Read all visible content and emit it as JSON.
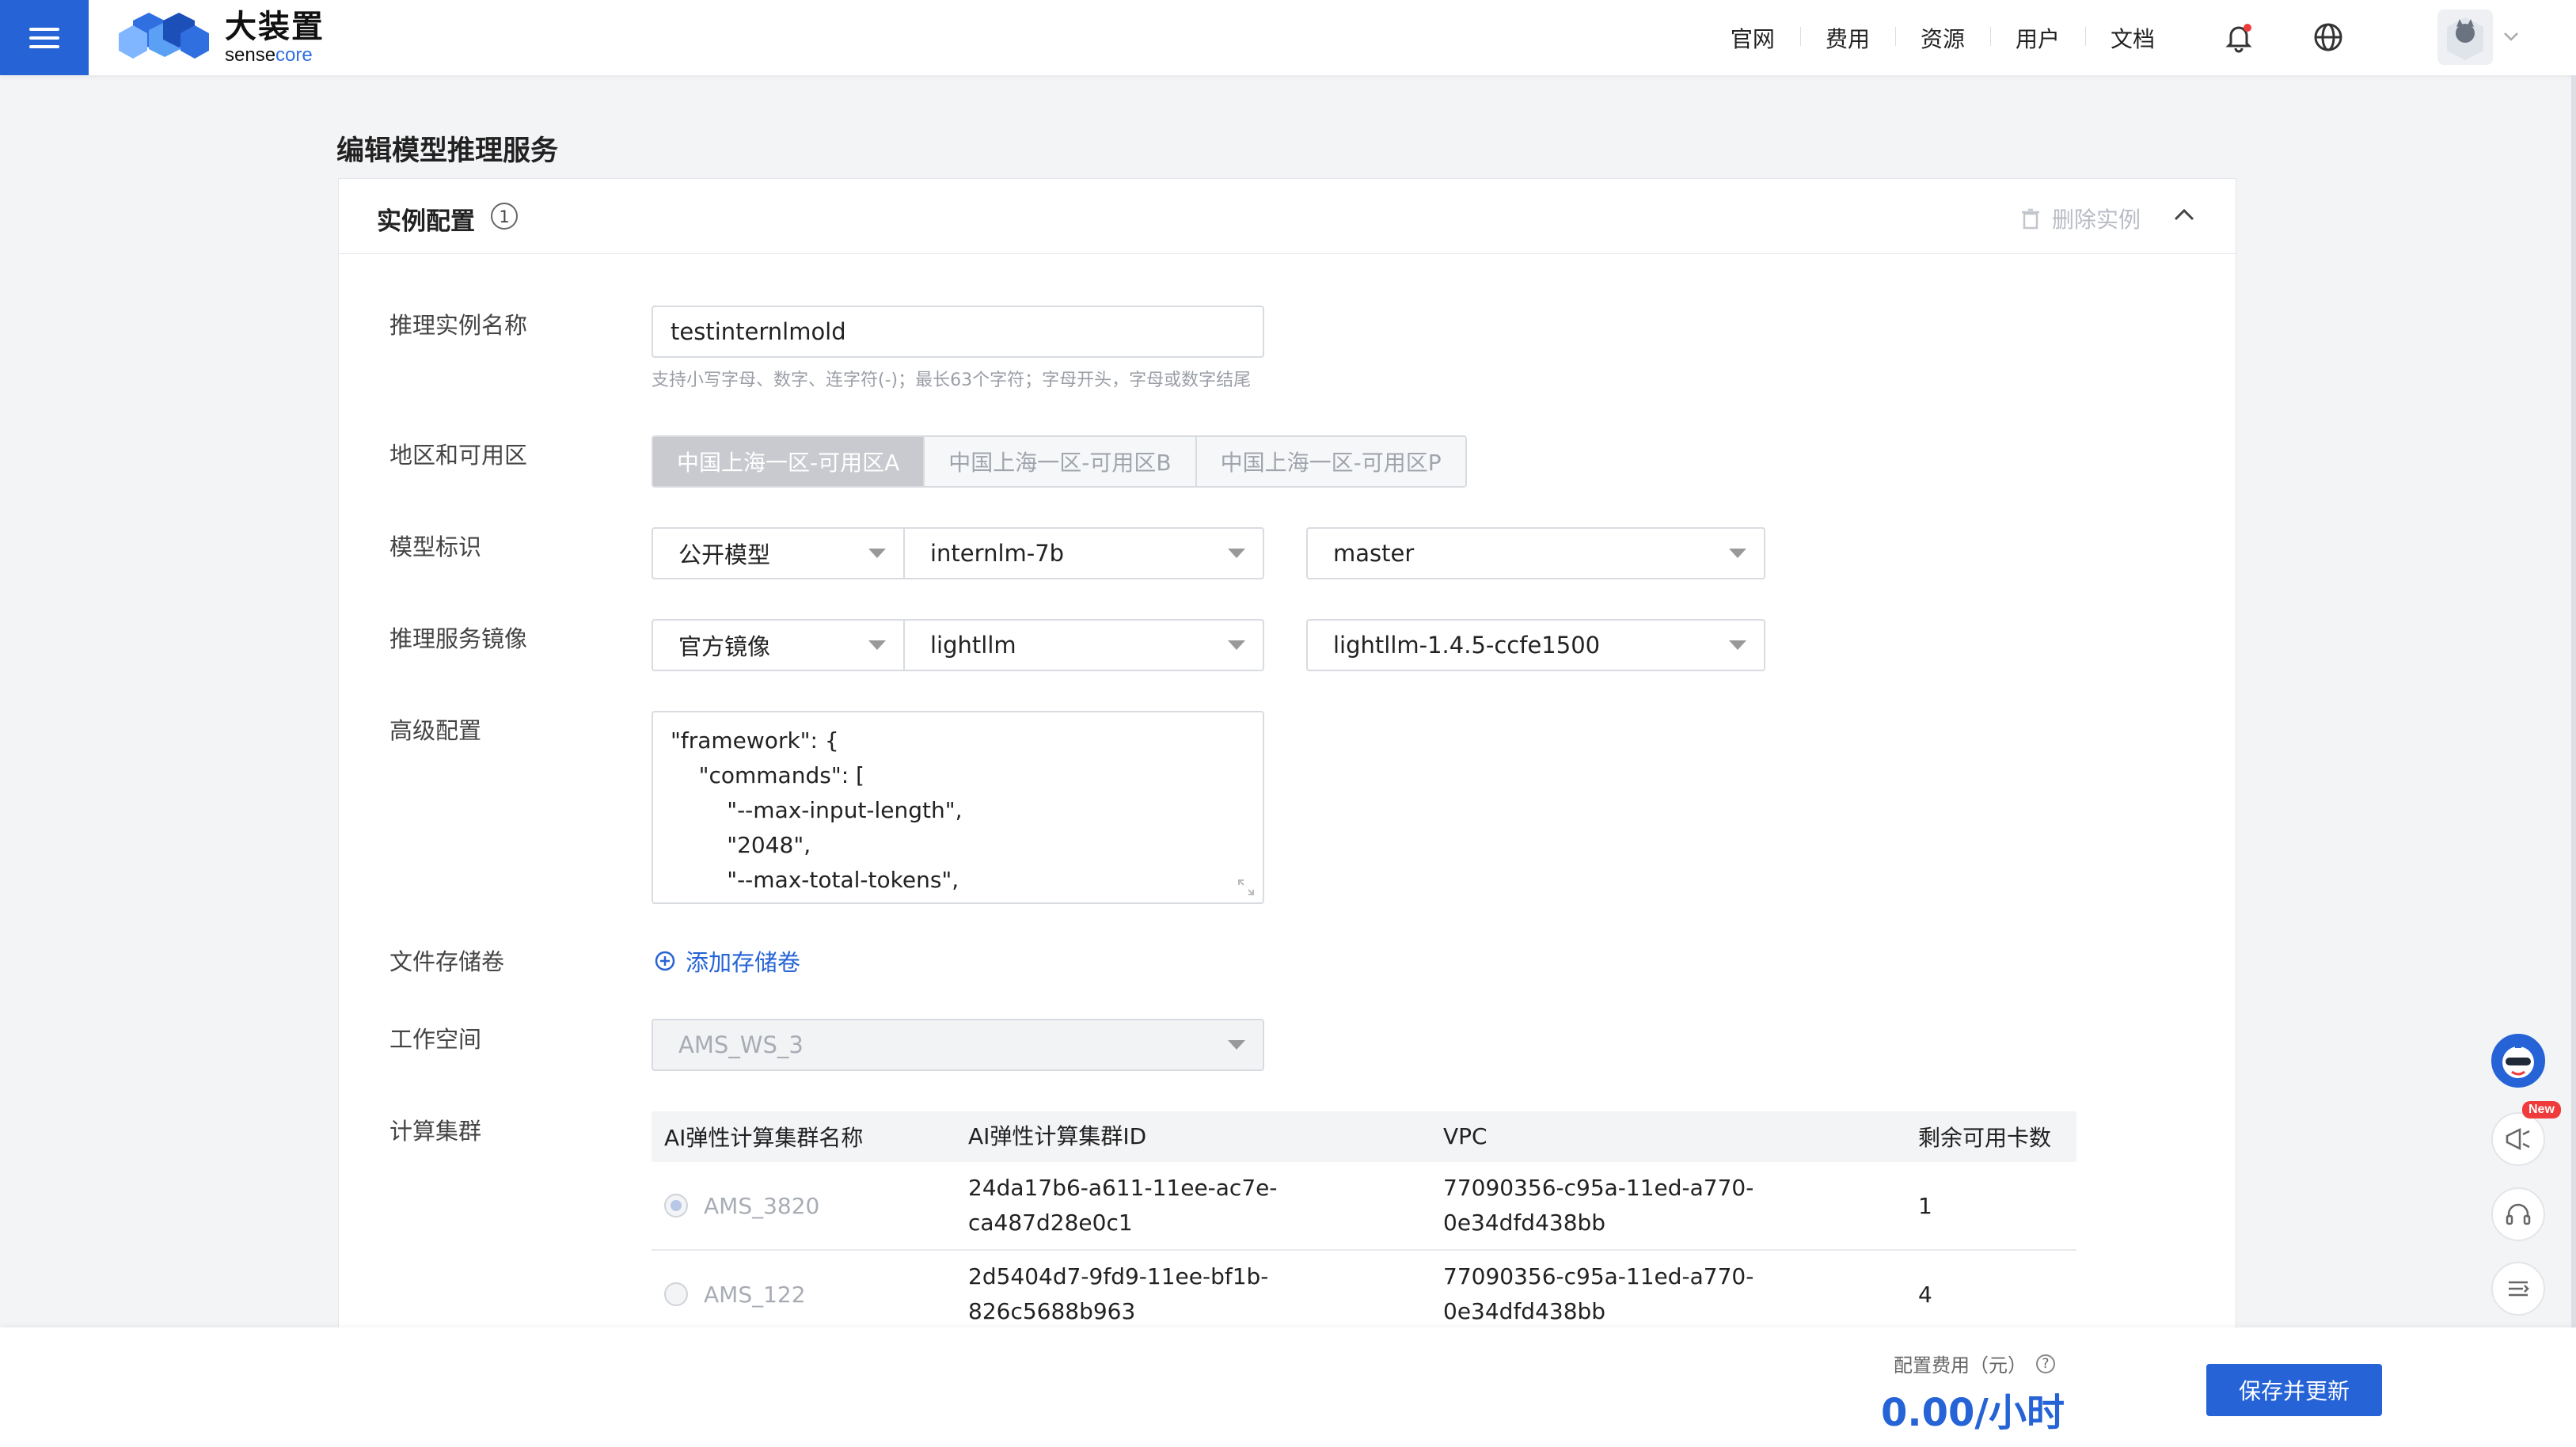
{
  "header": {
    "logo_title": "大装置",
    "logo_sub_a": "sense",
    "logo_sub_b": "core",
    "nav": [
      "官网",
      "费用",
      "资源",
      "用户",
      "文档"
    ]
  },
  "page": {
    "title": "编辑模型推理服务",
    "section_title": "实例配置",
    "section_number": "1",
    "delete_label": "删除实例"
  },
  "form": {
    "name_label": "推理实例名称",
    "name_value": "testinternlmold",
    "name_hint": "支持小写字母、数字、连字符(-)；最长63个字符；字母开头，字母或数字结尾",
    "region_label": "地区和可用区",
    "regions": [
      "中国上海一区-可用区A",
      "中国上海一区-可用区B",
      "中国上海一区-可用区P"
    ],
    "model_label": "模型标识",
    "model_type": "公开模型",
    "model_name": "internlm-7b",
    "model_version": "master",
    "image_label": "推理服务镜像",
    "image_type": "官方镜像",
    "image_name": "lightllm",
    "image_version": "lightllm-1.4.5-ccfe1500",
    "advanced_label": "高级配置",
    "advanced_lines": [
      "\"framework\": {",
      "    \"commands\": [",
      "        \"--max-input-length\",",
      "        \"2048\",",
      "        \"--max-total-tokens\","
    ],
    "storage_label": "文件存储卷",
    "add_storage": "添加存储卷",
    "workspace_label": "工作空间",
    "workspace_value": "AMS_WS_3",
    "cluster_label": "计算集群"
  },
  "cluster_table": {
    "headers": [
      "AI弹性计算集群名称",
      "AI弹性计算集群ID",
      "VPC",
      "剩余可用卡数"
    ],
    "rows": [
      {
        "name": "AMS_3820",
        "id1": "24da17b6-a611-11ee-ac7e-",
        "id2": "ca487d28e0c1",
        "vpc1": "77090356-c95a-11ed-a770-",
        "vpc2": "0e34dfd438bb",
        "cards": "1"
      },
      {
        "name": "AMS_122",
        "id1": "2d5404d7-9fd9-11ee-bf1b-",
        "id2": "826c5688b963",
        "vpc1": "77090356-c95a-11ed-a770-",
        "vpc2": "0e34dfd438bb",
        "cards": "4"
      }
    ]
  },
  "footer": {
    "fee_label": "配置费用（元）",
    "fee_value": "0.00/小时",
    "save_label": "保存并更新"
  },
  "float_badge": "New",
  "colors": {
    "primary": "#2563d6",
    "badge": "#ef3b3b"
  }
}
